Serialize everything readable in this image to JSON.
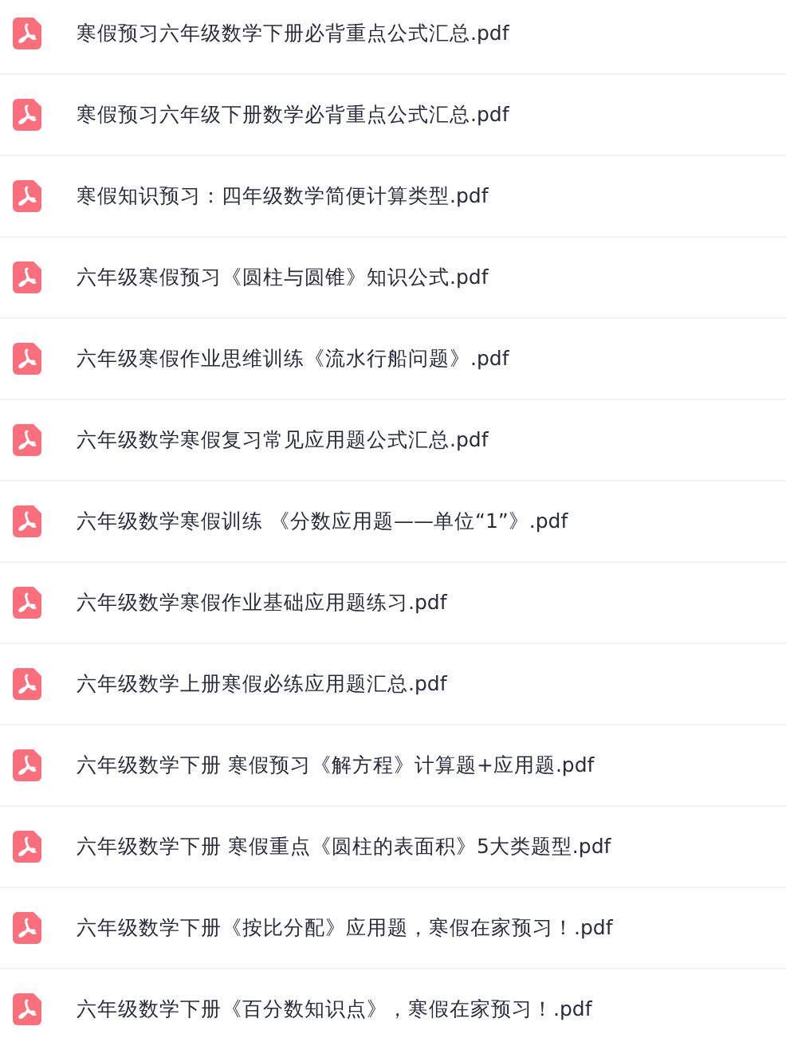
{
  "files": [
    {
      "name": "寒假预习六年级数学下册必背重点公式汇总.pdf",
      "kind": "pdf"
    },
    {
      "name": "寒假预习六年级下册数学必背重点公式汇总.pdf",
      "kind": "pdf"
    },
    {
      "name": "寒假知识预习：四年级数学简便计算类型.pdf",
      "kind": "pdf"
    },
    {
      "name": "六年级寒假预习《圆柱与圆锥》知识公式.pdf",
      "kind": "pdf"
    },
    {
      "name": "六年级寒假作业思维训练《流水行船问题》.pdf",
      "kind": "pdf"
    },
    {
      "name": "六年级数学寒假复习常见应用题公式汇总.pdf",
      "kind": "pdf"
    },
    {
      "name": "六年级数学寒假训练 《分数应用题——单位“1”》.pdf",
      "kind": "pdf"
    },
    {
      "name": "六年级数学寒假作业基础应用题练习.pdf",
      "kind": "pdf"
    },
    {
      "name": "六年级数学上册寒假必练应用题汇总.pdf",
      "kind": "pdf"
    },
    {
      "name": "六年级数学下册 寒假预习《解方程》计算题+应用题.pdf",
      "kind": "pdf"
    },
    {
      "name": "六年级数学下册 寒假重点《圆柱的表面积》5大类题型.pdf",
      "kind": "pdf"
    },
    {
      "name": "六年级数学下册《按比分配》应用题，寒假在家预习！.pdf",
      "kind": "pdf"
    },
    {
      "name": "六年级数学下册《百分数知识点》，寒假在家预习！.pdf",
      "kind": "pdf"
    }
  ]
}
